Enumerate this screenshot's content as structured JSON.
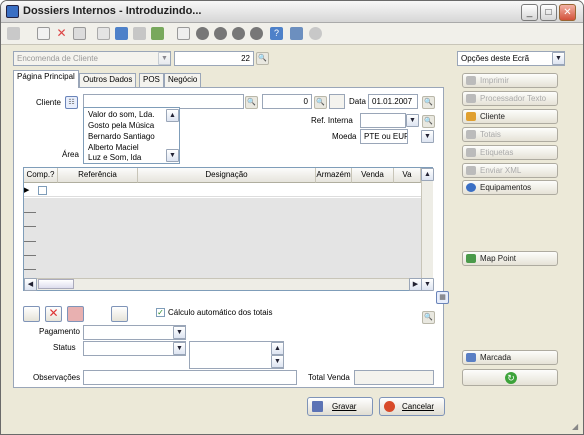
{
  "window": {
    "title": "Dossiers Internos - Introduzindo..."
  },
  "top": {
    "doc_type": "Encomenda de Cliente",
    "doc_number": "22",
    "screen_options": "Opções deste Ecrã"
  },
  "tabs": [
    {
      "label": "Página Principal"
    },
    {
      "label": "Outros Dados"
    },
    {
      "label": "POS"
    },
    {
      "label": "Negócio"
    }
  ],
  "form": {
    "cliente_label": "Cliente",
    "cliente_no": "0",
    "data_label": "Data",
    "data_value": "01.01.2007",
    "ref_label": "Ref. Interna",
    "moeda_label": "Moeda",
    "moeda_value": "PTE ou EURO",
    "area_label": "Área",
    "client_options": [
      "Valor do som, Lda.",
      "Gosto pela Música",
      "Bernardo Santiago",
      "Alberto Maciel",
      "Luz e Som, lda"
    ]
  },
  "grid": {
    "columns": [
      "Comp.?",
      "Referência",
      "Designação",
      "Armazém",
      "Venda",
      "Va"
    ]
  },
  "bottom": {
    "calc_label": "Cálculo automático dos totais",
    "pagamento_label": "Pagamento",
    "status_label": "Status",
    "obs_label": "Observações",
    "total_label": "Total Venda"
  },
  "actions": {
    "save": "Gravar",
    "cancel": "Cancelar"
  },
  "side": {
    "imprimir": "Imprimir",
    "processador": "Processador Texto",
    "cliente": "Cliente",
    "totais": "Totais",
    "etiquetas": "Etiquetas",
    "enviar_xml": "Enviar XML",
    "equipamentos": "Equipamentos",
    "map_point": "Map Point",
    "marcada": "Marcada"
  },
  "colors": {
    "accent": "#3a6fc4",
    "go": "#3da33a"
  }
}
